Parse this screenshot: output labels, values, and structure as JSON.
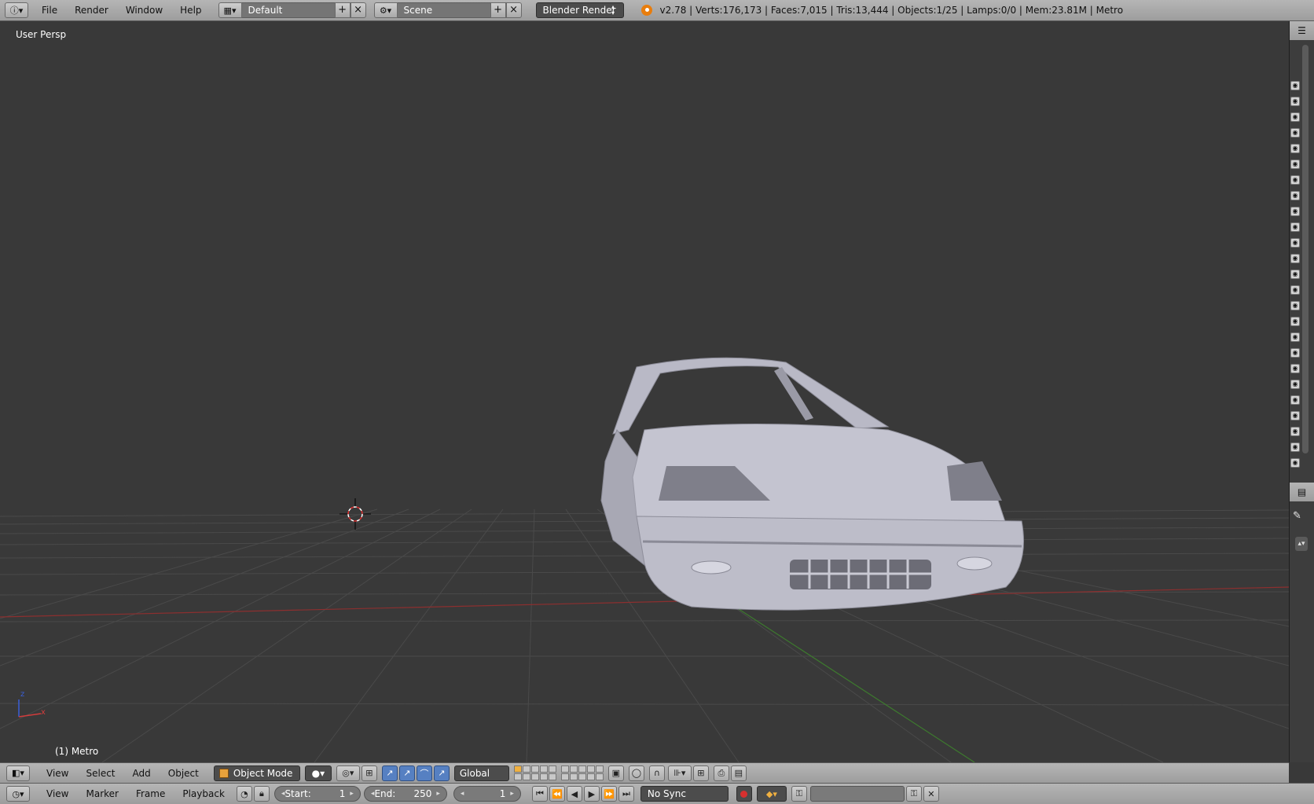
{
  "topbar": {
    "menus": [
      "File",
      "Render",
      "Window",
      "Help"
    ],
    "layout_name": "Default",
    "scene_name": "Scene",
    "render_engine": "Blender Render",
    "stats": "v2.78 | Verts:176,173 | Faces:7,015 | Tris:13,444 | Objects:1/25 | Lamps:0/0 | Mem:23.81M | Metro"
  },
  "viewport": {
    "view_label": "User Persp",
    "object_label": "(1) Metro",
    "axis_labels": {
      "z": "z",
      "x": "x"
    }
  },
  "view3d_header": {
    "menus": [
      "View",
      "Select",
      "Add",
      "Object"
    ],
    "mode": "Object Mode",
    "orientation": "Global"
  },
  "timeline": {
    "menus": [
      "View",
      "Marker",
      "Frame",
      "Playback"
    ],
    "start_label": "Start:",
    "start_value": "1",
    "end_label": "End:",
    "end_value": "250",
    "current_frame": "1",
    "sync": "No Sync"
  },
  "colors": {
    "header": "#a8a8a8",
    "viewport_bg": "#393939",
    "grid": "#4a4a4a",
    "x_axis": "#8c2f2f",
    "y_axis": "#3d7a2e",
    "accent": "#5680c2"
  }
}
